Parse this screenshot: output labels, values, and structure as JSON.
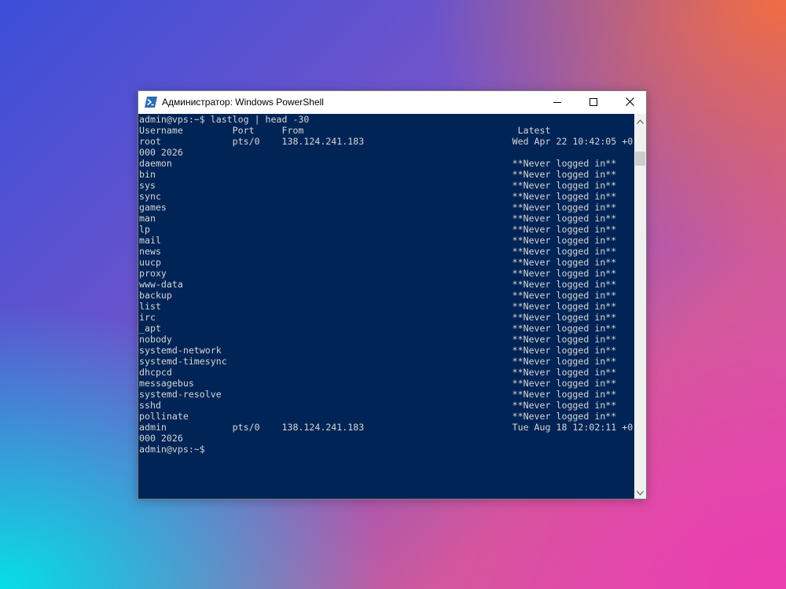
{
  "window": {
    "title": "Администратор: Windows PowerShell"
  },
  "colors": {
    "terminal_background": "#012456",
    "terminal_text": "#d6d6d6"
  },
  "icons": {
    "app": "powershell-icon",
    "minimize": "minimize-icon",
    "maximize": "maximize-icon",
    "close": "close-icon",
    "scroll_up": "chevron-up-icon",
    "scroll_down": "chevron-down-icon"
  },
  "terminal": {
    "lines": [
      "admin@vps:~$ lastlog | head -30",
      "Username         Port     From                                       Latest",
      "root             pts/0    138.124.241.183                           Wed Apr 22 10:42:05 +0",
      "000 2026",
      "daemon                                                              **Never logged in**",
      "bin                                                                 **Never logged in**",
      "sys                                                                 **Never logged in**",
      "sync                                                                **Never logged in**",
      "games                                                               **Never logged in**",
      "man                                                                 **Never logged in**",
      "lp                                                                  **Never logged in**",
      "mail                                                                **Never logged in**",
      "news                                                                **Never logged in**",
      "uucp                                                                **Never logged in**",
      "proxy                                                               **Never logged in**",
      "www-data                                                            **Never logged in**",
      "backup                                                              **Never logged in**",
      "list                                                                **Never logged in**",
      "irc                                                                 **Never logged in**",
      "_apt                                                                **Never logged in**",
      "nobody                                                              **Never logged in**",
      "systemd-network                                                     **Never logged in**",
      "systemd-timesync                                                    **Never logged in**",
      "dhcpcd                                                              **Never logged in**",
      "messagebus                                                          **Never logged in**",
      "systemd-resolve                                                     **Never logged in**",
      "sshd                                                                **Never logged in**",
      "pollinate                                                           **Never logged in**",
      "admin            pts/0    138.124.241.183                           Tue Aug 18 12:02:11 +0",
      "000 2026",
      "admin@vps:~$"
    ]
  }
}
